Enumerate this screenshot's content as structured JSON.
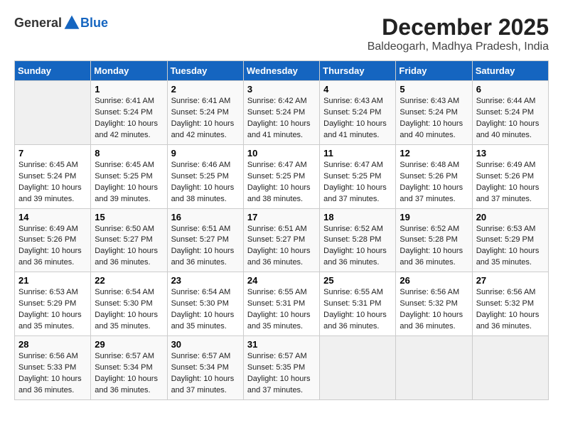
{
  "logo": {
    "general": "General",
    "blue": "Blue"
  },
  "title": "December 2025",
  "subtitle": "Baldeogarh, Madhya Pradesh, India",
  "days_of_week": [
    "Sunday",
    "Monday",
    "Tuesday",
    "Wednesday",
    "Thursday",
    "Friday",
    "Saturday"
  ],
  "weeks": [
    [
      {
        "day": "",
        "content": ""
      },
      {
        "day": "1",
        "content": "Sunrise: 6:41 AM\nSunset: 5:24 PM\nDaylight: 10 hours\nand 42 minutes."
      },
      {
        "day": "2",
        "content": "Sunrise: 6:41 AM\nSunset: 5:24 PM\nDaylight: 10 hours\nand 42 minutes."
      },
      {
        "day": "3",
        "content": "Sunrise: 6:42 AM\nSunset: 5:24 PM\nDaylight: 10 hours\nand 41 minutes."
      },
      {
        "day": "4",
        "content": "Sunrise: 6:43 AM\nSunset: 5:24 PM\nDaylight: 10 hours\nand 41 minutes."
      },
      {
        "day": "5",
        "content": "Sunrise: 6:43 AM\nSunset: 5:24 PM\nDaylight: 10 hours\nand 40 minutes."
      },
      {
        "day": "6",
        "content": "Sunrise: 6:44 AM\nSunset: 5:24 PM\nDaylight: 10 hours\nand 40 minutes."
      }
    ],
    [
      {
        "day": "7",
        "content": "Sunrise: 6:45 AM\nSunset: 5:24 PM\nDaylight: 10 hours\nand 39 minutes."
      },
      {
        "day": "8",
        "content": "Sunrise: 6:45 AM\nSunset: 5:25 PM\nDaylight: 10 hours\nand 39 minutes."
      },
      {
        "day": "9",
        "content": "Sunrise: 6:46 AM\nSunset: 5:25 PM\nDaylight: 10 hours\nand 38 minutes."
      },
      {
        "day": "10",
        "content": "Sunrise: 6:47 AM\nSunset: 5:25 PM\nDaylight: 10 hours\nand 38 minutes."
      },
      {
        "day": "11",
        "content": "Sunrise: 6:47 AM\nSunset: 5:25 PM\nDaylight: 10 hours\nand 37 minutes."
      },
      {
        "day": "12",
        "content": "Sunrise: 6:48 AM\nSunset: 5:26 PM\nDaylight: 10 hours\nand 37 minutes."
      },
      {
        "day": "13",
        "content": "Sunrise: 6:49 AM\nSunset: 5:26 PM\nDaylight: 10 hours\nand 37 minutes."
      }
    ],
    [
      {
        "day": "14",
        "content": "Sunrise: 6:49 AM\nSunset: 5:26 PM\nDaylight: 10 hours\nand 36 minutes."
      },
      {
        "day": "15",
        "content": "Sunrise: 6:50 AM\nSunset: 5:27 PM\nDaylight: 10 hours\nand 36 minutes."
      },
      {
        "day": "16",
        "content": "Sunrise: 6:51 AM\nSunset: 5:27 PM\nDaylight: 10 hours\nand 36 minutes."
      },
      {
        "day": "17",
        "content": "Sunrise: 6:51 AM\nSunset: 5:27 PM\nDaylight: 10 hours\nand 36 minutes."
      },
      {
        "day": "18",
        "content": "Sunrise: 6:52 AM\nSunset: 5:28 PM\nDaylight: 10 hours\nand 36 minutes."
      },
      {
        "day": "19",
        "content": "Sunrise: 6:52 AM\nSunset: 5:28 PM\nDaylight: 10 hours\nand 36 minutes."
      },
      {
        "day": "20",
        "content": "Sunrise: 6:53 AM\nSunset: 5:29 PM\nDaylight: 10 hours\nand 35 minutes."
      }
    ],
    [
      {
        "day": "21",
        "content": "Sunrise: 6:53 AM\nSunset: 5:29 PM\nDaylight: 10 hours\nand 35 minutes."
      },
      {
        "day": "22",
        "content": "Sunrise: 6:54 AM\nSunset: 5:30 PM\nDaylight: 10 hours\nand 35 minutes."
      },
      {
        "day": "23",
        "content": "Sunrise: 6:54 AM\nSunset: 5:30 PM\nDaylight: 10 hours\nand 35 minutes."
      },
      {
        "day": "24",
        "content": "Sunrise: 6:55 AM\nSunset: 5:31 PM\nDaylight: 10 hours\nand 35 minutes."
      },
      {
        "day": "25",
        "content": "Sunrise: 6:55 AM\nSunset: 5:31 PM\nDaylight: 10 hours\nand 36 minutes."
      },
      {
        "day": "26",
        "content": "Sunrise: 6:56 AM\nSunset: 5:32 PM\nDaylight: 10 hours\nand 36 minutes."
      },
      {
        "day": "27",
        "content": "Sunrise: 6:56 AM\nSunset: 5:32 PM\nDaylight: 10 hours\nand 36 minutes."
      }
    ],
    [
      {
        "day": "28",
        "content": "Sunrise: 6:56 AM\nSunset: 5:33 PM\nDaylight: 10 hours\nand 36 minutes."
      },
      {
        "day": "29",
        "content": "Sunrise: 6:57 AM\nSunset: 5:34 PM\nDaylight: 10 hours\nand 36 minutes."
      },
      {
        "day": "30",
        "content": "Sunrise: 6:57 AM\nSunset: 5:34 PM\nDaylight: 10 hours\nand 37 minutes."
      },
      {
        "day": "31",
        "content": "Sunrise: 6:57 AM\nSunset: 5:35 PM\nDaylight: 10 hours\nand 37 minutes."
      },
      {
        "day": "",
        "content": ""
      },
      {
        "day": "",
        "content": ""
      },
      {
        "day": "",
        "content": ""
      }
    ]
  ]
}
